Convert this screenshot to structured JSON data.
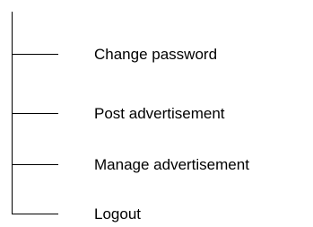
{
  "menu": {
    "items": [
      {
        "label": "Change password"
      },
      {
        "label": "Post advertisement"
      },
      {
        "label": "Manage advertisement"
      },
      {
        "label": "Logout"
      }
    ]
  }
}
